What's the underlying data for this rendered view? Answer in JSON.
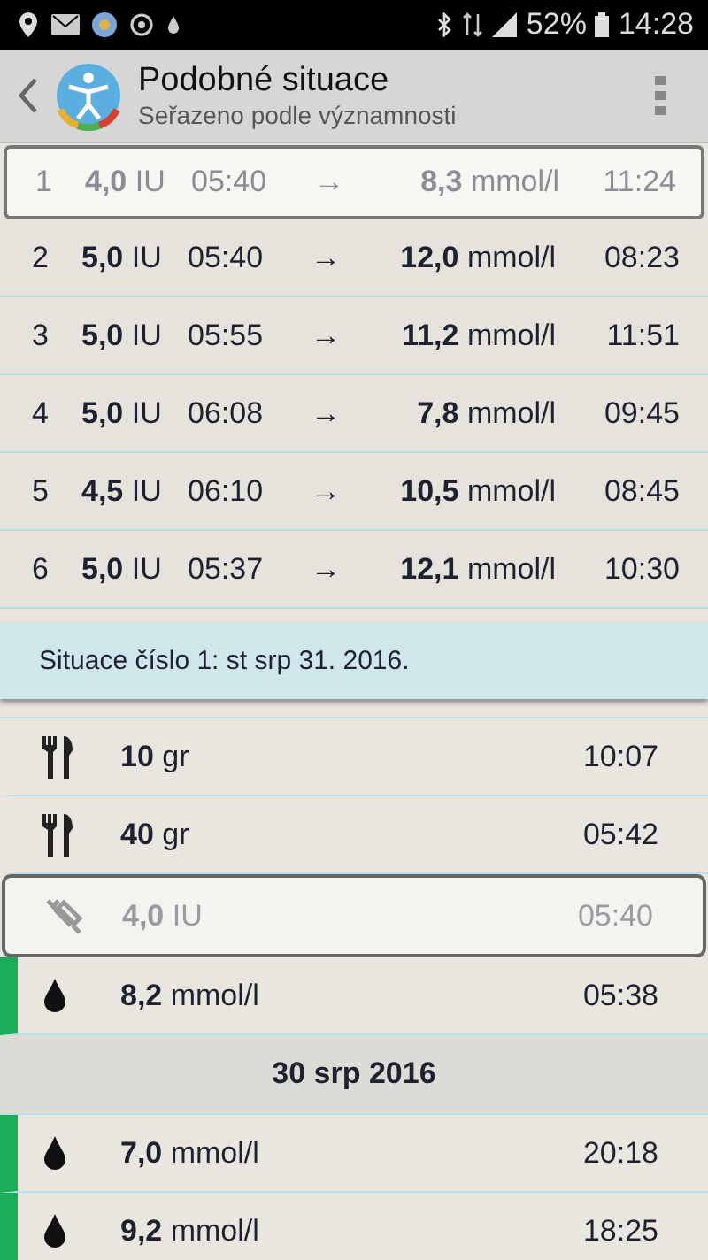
{
  "status_bar": {
    "battery": "52%",
    "time": "14:28"
  },
  "header": {
    "title": "Podobné situace",
    "subtitle": "Seřazeno podle významnosti"
  },
  "situations": [
    {
      "index": "1",
      "dose": "**4,0** IU",
      "dose_time": "05:40",
      "arrow": "→",
      "glucose": "**8,3** mmol/l",
      "glucose_time": "11:24",
      "selected": true
    },
    {
      "index": "2",
      "dose": "**5,0** IU",
      "dose_time": "05:40",
      "arrow": "→",
      "glucose": "**12,0** mmol/l",
      "glucose_time": "08:23",
      "selected": false
    },
    {
      "index": "3",
      "dose": "**5,0** IU",
      "dose_time": "05:55",
      "arrow": "→",
      "glucose": "**11,2** mmol/l",
      "glucose_time": "11:51",
      "selected": false
    },
    {
      "index": "4",
      "dose": "**5,0** IU",
      "dose_time": "06:08",
      "arrow": "→",
      "glucose": "**7,8** mmol/l",
      "glucose_time": "09:45",
      "selected": false
    },
    {
      "index": "5",
      "dose": "**4,5** IU",
      "dose_time": "06:10",
      "arrow": "→",
      "glucose": "**10,5** mmol/l",
      "glucose_time": "08:45",
      "selected": false
    },
    {
      "index": "6",
      "dose": "**5,0** IU",
      "dose_time": "05:37",
      "arrow": "→",
      "glucose": "**12,1** mmol/l",
      "glucose_time": "10:30",
      "selected": false
    }
  ],
  "detail_banner": "Situace číslo 1: st srp 31. 2016.",
  "entries": [
    {
      "kind": "meal",
      "value": "**10** gr",
      "time": "10:07",
      "selected": false
    },
    {
      "kind": "meal",
      "value": "**40** gr",
      "time": "05:42",
      "selected": false
    },
    {
      "kind": "insulin",
      "value": "**4,0** IU",
      "time": "05:40",
      "selected": true
    },
    {
      "kind": "glucose",
      "value": "**8,2** mmol/l",
      "time": "05:38",
      "selected": false
    },
    {
      "kind": "date",
      "value": "30 srp 2016"
    },
    {
      "kind": "glucose",
      "value": "**7,0** mmol/l",
      "time": "20:18",
      "selected": false
    },
    {
      "kind": "glucose",
      "value": "**9,2** mmol/l",
      "time": "18:25",
      "selected": false
    }
  ]
}
